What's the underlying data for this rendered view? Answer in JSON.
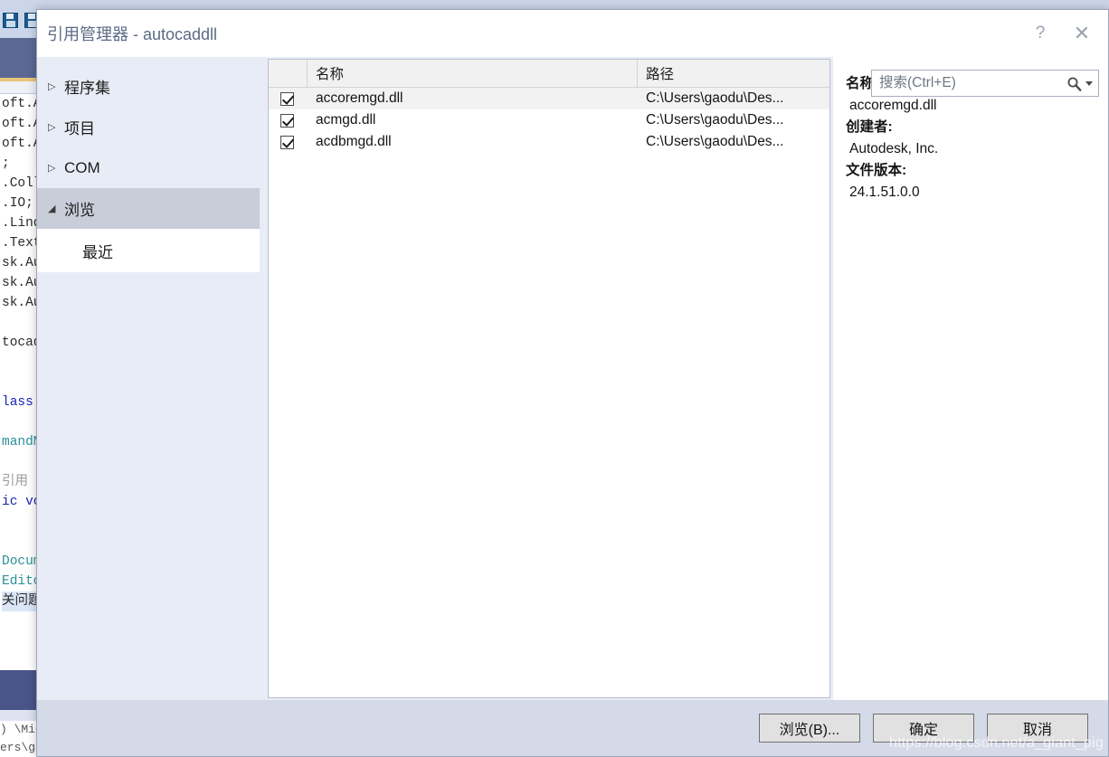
{
  "dialog": {
    "title": "引用管理器 - autocaddll",
    "help_button": "?",
    "close_button": "✕"
  },
  "search": {
    "placeholder": "搜索(Ctrl+E)",
    "value": "",
    "icon": "search-icon",
    "dropdown_icon": "chevron-down-icon"
  },
  "sidebar": {
    "items": [
      {
        "label": "程序集",
        "expander": "▷",
        "selected": false
      },
      {
        "label": "项目",
        "expander": "▷",
        "selected": false
      },
      {
        "label": "COM",
        "expander": "▷",
        "selected": false
      },
      {
        "label": "浏览",
        "expander": "◢",
        "selected": true
      }
    ],
    "sub_item": {
      "label": "最近"
    }
  },
  "list": {
    "columns": [
      "",
      "名称",
      "路径"
    ],
    "rows": [
      {
        "checked": true,
        "name": "accoremgd.dll",
        "path": "C:\\Users\\gaodu\\Des...",
        "hovered": true
      },
      {
        "checked": true,
        "name": "acmgd.dll",
        "path": "C:\\Users\\gaodu\\Des...",
        "hovered": false
      },
      {
        "checked": true,
        "name": "acdbmgd.dll",
        "path": "C:\\Users\\gaodu\\Des...",
        "hovered": false
      }
    ]
  },
  "details": {
    "name_label": "名称:",
    "name_value": "accoremgd.dll",
    "creator_label": "创建者:",
    "creator_value": "Autodesk, Inc.",
    "version_label": "文件版本:",
    "version_value": "24.1.51.0.0"
  },
  "footer": {
    "browse_label": "浏览(B)...",
    "ok_label": "确定",
    "cancel_label": "取消"
  },
  "background": {
    "code_lines": [
      "oft.A",
      "oft.A",
      "oft.A",
      ";",
      ".Coll",
      ".IO;",
      ".Linq",
      ".Text",
      "sk.Au",
      "sk.Au",
      "sk.Au",
      "",
      "tocad",
      "",
      "",
      "lass",
      "",
      "mandM",
      "",
      "引用",
      "ic vo",
      "",
      "",
      "Docum",
      "Edito",
      "关问题"
    ],
    "output_line_1": ") \\Mic",
    "output_line_2": "ers\\gaodu\\Desktop\\autocaddll\\autocaddll\\bin\\Debug\\autocaddll.dll"
  },
  "watermark": "https://blog.csdn.net/a_giant_pig"
}
